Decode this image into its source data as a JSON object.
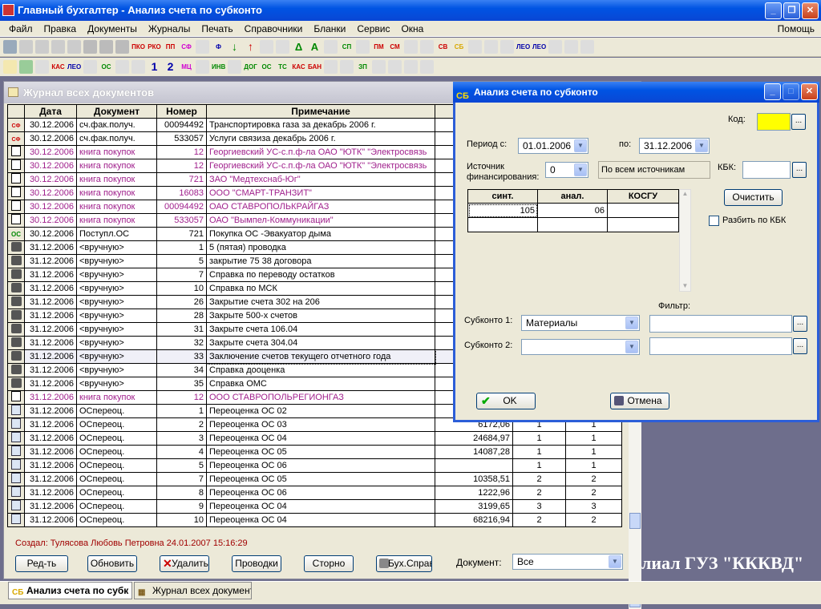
{
  "app": {
    "title": "Главный бухгалтер - Анализ счета по субконто",
    "window_buttons": [
      "_",
      "❐",
      "✕"
    ]
  },
  "menu": {
    "items": [
      "Файл",
      "Правка",
      "Документы",
      "Журналы",
      "Печать",
      "Справочники",
      "Бланки",
      "Сервис",
      "Окна"
    ],
    "help": "Помощь"
  },
  "toolbar1": [
    "ПКО",
    "РКО",
    "ПП",
    "СФ",
    "Ф",
    "СП ОС",
    "ПМ",
    "СМ",
    "СВ ОД",
    "СБ",
    "ЛЕО ЛП",
    "ЛЕО ИСП"
  ],
  "toolbar2": [
    "КАС СЧ",
    "ЛЕО",
    "ОС",
    "1",
    "2",
    "МЦ",
    "ИНВ",
    "ДОГ",
    "ОС",
    "ТС",
    "КАС",
    "БАН",
    "ЗП"
  ],
  "journal": {
    "title": "Журнал всех документов",
    "columns": [
      "Дата",
      "Документ",
      "Номер",
      "Примечание"
    ],
    "rows": [
      {
        "icon": "invoice-icon",
        "date": "30.12.2006",
        "doc": "сч.фак.получ.",
        "num": "00094492",
        "note": "Транспортировка газа за декабрь 2006 г.",
        "sum": "",
        "a": "",
        "b": "",
        "purple": false
      },
      {
        "icon": "invoice-icon",
        "date": "30.12.2006",
        "doc": "сч.фак.получ.",
        "num": "533057",
        "note": "Услуги связиза декабрь 2006 г.",
        "sum": "",
        "a": "",
        "b": "",
        "purple": false
      },
      {
        "icon": "book-icon",
        "date": "30.12.2006",
        "doc": "книга покупок",
        "num": "12",
        "note": "Георгиевский УС-с.п.ф-ла ОАО \"ЮТК\" \"Электросвязь",
        "sum": "",
        "a": "",
        "b": "",
        "purple": true
      },
      {
        "icon": "book-icon",
        "date": "30.12.2006",
        "doc": "книга покупок",
        "num": "12",
        "note": "Георгиевский УС-с.п.ф-ла ОАО \"ЮТК\" \"Электросвязь",
        "sum": "",
        "a": "",
        "b": "",
        "purple": true
      },
      {
        "icon": "book-icon",
        "date": "30.12.2006",
        "doc": "книга покупок",
        "num": "721",
        "note": "ЗАО \"Медтехснаб-Юг\"",
        "sum": "",
        "a": "",
        "b": "",
        "purple": true
      },
      {
        "icon": "book-icon",
        "date": "30.12.2006",
        "doc": "книга покупок",
        "num": "16083",
        "note": "ООО \"СМАРТ-ТРАНЗИТ\"",
        "sum": "",
        "a": "",
        "b": "",
        "purple": true
      },
      {
        "icon": "book-icon",
        "date": "30.12.2006",
        "doc": "книга покупок",
        "num": "00094492",
        "note": "ОАО СТАВРОПОЛЬКРАЙГАЗ",
        "sum": "",
        "a": "",
        "b": "",
        "purple": true
      },
      {
        "icon": "book-icon",
        "date": "30.12.2006",
        "doc": "книга покупок",
        "num": "533057",
        "note": "ОАО \"Вымпел-Коммуникации\"",
        "sum": "",
        "a": "",
        "b": "",
        "purple": true
      },
      {
        "icon": "os-icon",
        "date": "30.12.2006",
        "doc": "Поступл.ОС",
        "num": "721",
        "note": "Покупка ОС   -Эвакуатор дыма",
        "sum": "",
        "a": "",
        "b": "",
        "purple": false
      },
      {
        "icon": "hand-icon",
        "date": "31.12.2006",
        "doc": "<вручную>",
        "num": "1",
        "note": "5 (пятая) проводка",
        "sum": "",
        "a": "",
        "b": "",
        "purple": false
      },
      {
        "icon": "hand-icon",
        "date": "31.12.2006",
        "doc": "<вручную>",
        "num": "5",
        "note": "закрытие 75 38 договора",
        "sum": "",
        "a": "",
        "b": "",
        "purple": false
      },
      {
        "icon": "hand-icon",
        "date": "31.12.2006",
        "doc": "<вручную>",
        "num": "7",
        "note": "Справка  по переводу остатков",
        "sum": "",
        "a": "",
        "b": "",
        "purple": false
      },
      {
        "icon": "hand-icon",
        "date": "31.12.2006",
        "doc": "<вручную>",
        "num": "10",
        "note": "Справка по МСК",
        "sum": "",
        "a": "",
        "b": "",
        "purple": false
      },
      {
        "icon": "hand-icon",
        "date": "31.12.2006",
        "doc": "<вручную>",
        "num": "26",
        "note": "Закрытие счета 302 на 206",
        "sum": "",
        "a": "",
        "b": "",
        "purple": false
      },
      {
        "icon": "hand-icon",
        "date": "31.12.2006",
        "doc": "<вручную>",
        "num": "28",
        "note": "Закрыте 500-х счетов",
        "sum": "",
        "a": "",
        "b": "",
        "purple": false
      },
      {
        "icon": "hand-icon",
        "date": "31.12.2006",
        "doc": "<вручную>",
        "num": "31",
        "note": "Закрыте счета 106.04",
        "sum": "",
        "a": "",
        "b": "",
        "purple": false
      },
      {
        "icon": "hand-icon",
        "date": "31.12.2006",
        "doc": "<вручную>",
        "num": "32",
        "note": "Закрыте счета 304.04",
        "sum": "",
        "a": "",
        "b": "",
        "purple": false
      },
      {
        "icon": "hand-icon",
        "date": "31.12.2006",
        "doc": "<вручную>",
        "num": "33",
        "note": "Заключение счетов текущего отчетного года",
        "sum": "",
        "a": "",
        "b": "",
        "purple": false,
        "selected": true
      },
      {
        "icon": "hand-icon",
        "date": "31.12.2006",
        "doc": "<вручную>",
        "num": "34",
        "note": "Справка дооценка",
        "sum": "",
        "a": "",
        "b": "",
        "purple": false
      },
      {
        "icon": "hand-icon",
        "date": "31.12.2006",
        "doc": "<вручную>",
        "num": "35",
        "note": "Справка  ОМС",
        "sum": "",
        "a": "",
        "b": "",
        "purple": false
      },
      {
        "icon": "book-icon",
        "date": "31.12.2006",
        "doc": "книга покупок",
        "num": "12",
        "note": "ООО СТАВРОПОЛЬРЕГИОНГАЗ",
        "sum": "",
        "a": "",
        "b": "",
        "purple": true
      },
      {
        "icon": "doc-icon",
        "date": "31.12.2006",
        "doc": "ОСпереоц.",
        "num": "1",
        "note": "Переоценка ОС  02",
        "sum": "",
        "a": "",
        "b": "",
        "purple": false
      },
      {
        "icon": "doc-icon",
        "date": "31.12.2006",
        "doc": "ОСпереоц.",
        "num": "2",
        "note": "Переоценка ОС  03",
        "sum": "6172,06",
        "a": "1",
        "b": "1",
        "purple": false
      },
      {
        "icon": "doc-icon",
        "date": "31.12.2006",
        "doc": "ОСпереоц.",
        "num": "3",
        "note": "Переоценка ОС 04",
        "sum": "24684,97",
        "a": "1",
        "b": "1",
        "purple": false
      },
      {
        "icon": "doc-icon",
        "date": "31.12.2006",
        "doc": "ОСпереоц.",
        "num": "4",
        "note": "Переоценка ОС  05",
        "sum": "14087,28",
        "a": "1",
        "b": "1",
        "purple": false
      },
      {
        "icon": "doc-icon",
        "date": "31.12.2006",
        "doc": "ОСпереоц.",
        "num": "5",
        "note": "Переоценка ОС  06",
        "sum": "",
        "a": "1",
        "b": "1",
        "purple": false
      },
      {
        "icon": "doc-icon",
        "date": "31.12.2006",
        "doc": "ОСпереоц.",
        "num": "7",
        "note": "Переоценка ОС  05",
        "sum": "10358,51",
        "a": "2",
        "b": "2",
        "purple": false
      },
      {
        "icon": "doc-icon",
        "date": "31.12.2006",
        "doc": "ОСпереоц.",
        "num": "8",
        "note": "Переоценка ОС  06",
        "sum": "1222,96",
        "a": "2",
        "b": "2",
        "purple": false
      },
      {
        "icon": "doc-icon",
        "date": "31.12.2006",
        "doc": "ОСпереоц.",
        "num": "9",
        "note": "Переоценка ОС 04",
        "sum": "3199,65",
        "a": "3",
        "b": "3",
        "purple": false
      },
      {
        "icon": "doc-icon",
        "date": "31.12.2006",
        "doc": "ОСпереоц.",
        "num": "10",
        "note": "Переоценка ОС  04",
        "sum": "68216,94",
        "a": "2",
        "b": "2",
        "purple": false
      }
    ],
    "creator": "Создал: Тулясова Любовь Петровна 24.01.2007 15:16:29",
    "buttons": {
      "edit": "Ред-ть",
      "refresh": "Обновить",
      "delete": "Удалить",
      "postings": "Проводки",
      "storno": "Сторно",
      "buh": "Бух.Справк"
    },
    "doc_label": "Документ:",
    "doc_value": "Все"
  },
  "background_text": "лиал ГУЗ \"КККВД\"",
  "dialog": {
    "badge": "СБ",
    "title": "Анализ счета по субконто",
    "kod_label": "Код:",
    "kod_value": "",
    "period_label": "Период с:",
    "period_from": "01.01.2006",
    "period_to_label": "по:",
    "period_to": "31.12.2006",
    "source_label": "Источник финансирования:",
    "source_value": "0",
    "source_text": "По всем источникам",
    "kbk_label": "КБК:",
    "kbk_value": "",
    "table_cols": [
      "синт.",
      "анал.",
      "КОСГУ"
    ],
    "table_rows": [
      [
        "105",
        "06",
        ""
      ],
      [
        "",
        "",
        ""
      ]
    ],
    "clear_button": "Очистить",
    "split_kbk": "Разбить по КБК",
    "filter_label": "Фильтр:",
    "sub1_label": "Субконто 1:",
    "sub1_value": "Материалы",
    "sub1_filter": "",
    "sub2_label": "Субконто 2:",
    "sub2_value": "",
    "sub2_filter": "",
    "ok": "OK",
    "cancel": "Отмена"
  },
  "taskbar": {
    "tasks": [
      {
        "badge": "СБ",
        "label": "Анализ счета по субк"
      },
      {
        "badge": "▦",
        "label": "Журнал всех документо"
      }
    ]
  }
}
